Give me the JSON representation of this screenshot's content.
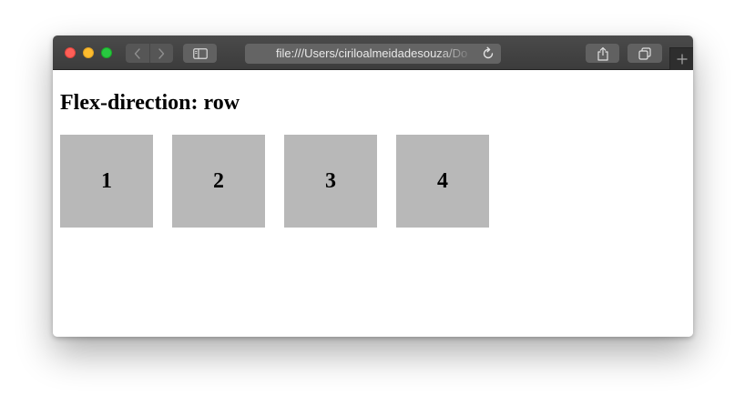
{
  "browser": {
    "address": "file:///Users/ciriloalmeidadesouza/Do",
    "icons": {
      "back": "chevron-left-icon",
      "forward": "chevron-right-icon",
      "sidebar": "sidebar-icon",
      "reload": "reload-icon",
      "share": "share-icon",
      "tabs": "tabs-icon",
      "new_tab": "plus-icon"
    },
    "colors": {
      "close": "#fe5f57",
      "minimize": "#febc2e",
      "maximize": "#28c840",
      "chrome": "#3f3f3f"
    }
  },
  "page": {
    "heading": "Flex-direction: row",
    "items": [
      "1",
      "2",
      "3",
      "4"
    ],
    "item_color": "#b8b8b8"
  }
}
